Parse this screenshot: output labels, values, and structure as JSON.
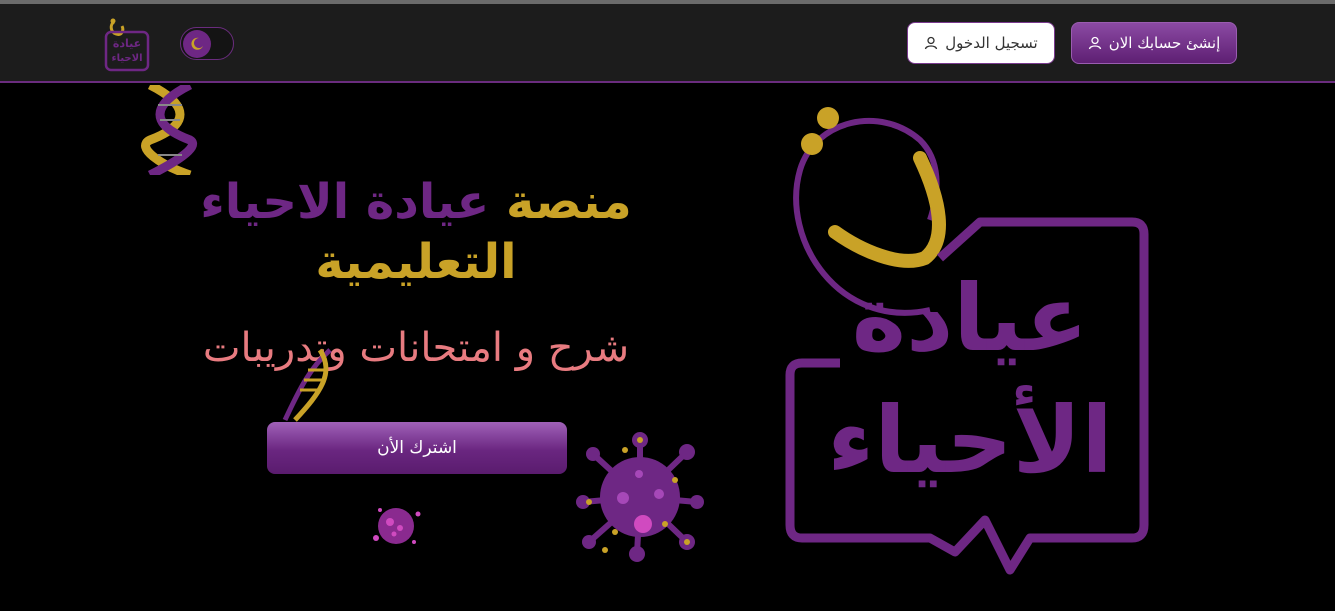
{
  "header": {
    "logo_text_line1": "عيادة",
    "logo_text_line2": "الاحياء",
    "theme_toggle_icon": "moon-icon",
    "create_account_label": "إنشئ حسابك الان",
    "login_label": "تسجيل الدخول",
    "user_icon": "user-icon"
  },
  "hero": {
    "title_word_platform": "منصة",
    "title_name": "عيادة الاحياء",
    "title_educational": "التعليمية",
    "subtitle": "شرح و امتحانات وتدريبات",
    "cta_label": "اشترك الأن"
  },
  "brand_logo": {
    "line1": "عيادة",
    "line2": "الأحياء"
  },
  "colors": {
    "gold": "#c9a227",
    "purple": "#6e2784",
    "coral": "#e87b80",
    "navbar_bg": "#1c1c1c",
    "page_bg": "#000000"
  }
}
